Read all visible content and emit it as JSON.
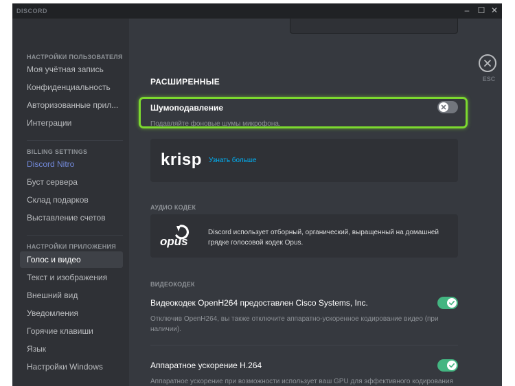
{
  "app": {
    "brand": "DISCORD"
  },
  "window_controls": {
    "minimize": "–",
    "maximize": "☐",
    "close": "✕"
  },
  "sidebar": {
    "user_settings": {
      "header": "НАСТРОЙКИ ПОЛЬЗОВАТЕЛЯ",
      "items": [
        "Моя учётная запись",
        "Конфиденциальность",
        "Авторизованные прил...",
        "Интеграции"
      ]
    },
    "billing": {
      "header": "BILLING SETTINGS",
      "items": [
        "Discord Nitro",
        "Буст сервера",
        "Склад подарков",
        "Выставление счетов"
      ]
    },
    "app_settings": {
      "header": "НАСТРОЙКИ ПРИЛОЖЕНИЯ",
      "items": [
        "Голос и видео",
        "Текст и изображения",
        "Внешний вид",
        "Уведомления",
        "Горячие клавиши",
        "Язык",
        "Настройки Windows"
      ],
      "active_index": 0
    }
  },
  "close": {
    "label": "ESC"
  },
  "main": {
    "section_title": "РАСШИРЕННЫЕ",
    "noise": {
      "label": "Шумоподавление",
      "description": "Подавляйте фоновые шумы микрофона.",
      "enabled": false
    },
    "krisp": {
      "logo": "krisp",
      "link": "Узнать больше"
    },
    "audio_codec": {
      "header": "АУДИО КОДЕК",
      "logo": "opus",
      "text_line1": "Discord использует отборный, органический, выращенный на домашней",
      "text_line2": "грядке голосовой кодек Opus."
    },
    "video_codec": {
      "header": "ВИДЕОКОДЕК",
      "label": "Видеокодек OpenH264 предоставлен Cisco Systems, Inc.",
      "desc_line1": "Отключив OpenH264, вы также отключите аппаратно-ускоренное кодирование видео (при",
      "desc_line2": "наличии).",
      "enabled": true
    },
    "hw_accel": {
      "label": "Аппаратное ускорение H.264",
      "description": "Аппаратное ускорение при возможности использует ваш GPU для эффективного кодирования",
      "enabled": true
    }
  },
  "colors": {
    "accent_green": "#43b581",
    "highlight_green": "#7cd92f",
    "toggle_off": "#72767d",
    "nitro": "#7289da",
    "link": "#00b0f4"
  }
}
